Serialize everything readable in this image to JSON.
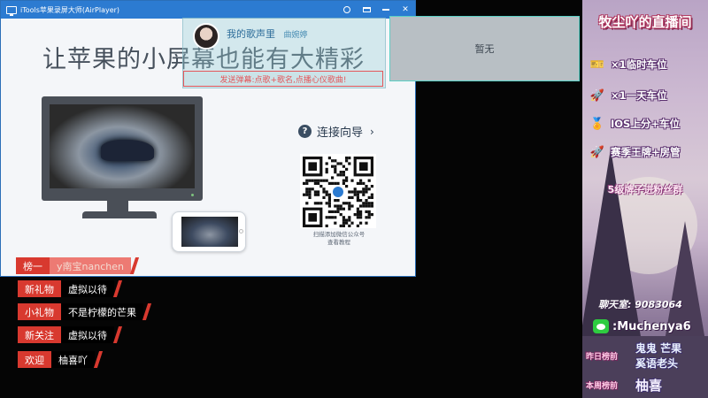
{
  "window": {
    "title": "iTools苹果录屏大师(AirPlayer)",
    "slogan": "让苹果的小屏幕也能有大精彩",
    "guide_label": "连接向导",
    "qr_caption_line1": "扫描添加微信公众号",
    "qr_caption_line2": "查看教程",
    "controls": [
      "pin-icon",
      "mini-mode-icon",
      "minimize-icon",
      "close-icon"
    ],
    "close_glyph": "✕",
    "accent_color": "#2c7bd1"
  },
  "music": {
    "song_title": "我的歌声里",
    "artist": "曲婉婷",
    "danmu_hint": "发送弹幕:点歌+歌名,点播心仪歌曲!"
  },
  "panel": {
    "empty_text": "暂无"
  },
  "chat": {
    "rank": {
      "tag": "榜一",
      "text": "y南宝nanchen"
    },
    "rows": [
      {
        "tag": "新礼物",
        "text": "虚拟以待"
      },
      {
        "tag": "小礼物",
        "text": "不是柠檬的芒果"
      },
      {
        "tag": "新关注",
        "text": "虚拟以待"
      },
      {
        "tag": "欢迎",
        "text": "柚喜吖"
      }
    ],
    "tag_color": "#d8392f"
  },
  "sidebar": {
    "title": "牧尘吖的直播间",
    "perks": [
      {
        "icon": "ticket-icon",
        "text": "×1临时车位"
      },
      {
        "icon": "rocket-icon",
        "text": "×1一天车位"
      },
      {
        "icon": "badge-icon",
        "text": "IOS上分+车位"
      },
      {
        "icon": "rocket-icon",
        "text": "赛季王牌+房管"
      }
    ],
    "fan_group": "5级牌子进粉丝群",
    "qq_group": "聊天室: 9083064",
    "wechat": ":Muchenya6",
    "yesterday_label": "昨日榜前",
    "yesterday_1": "鬼鬼 芒果",
    "yesterday_2": "奚语老头",
    "week_label": "本周榜前",
    "week_value": "柚喜"
  }
}
